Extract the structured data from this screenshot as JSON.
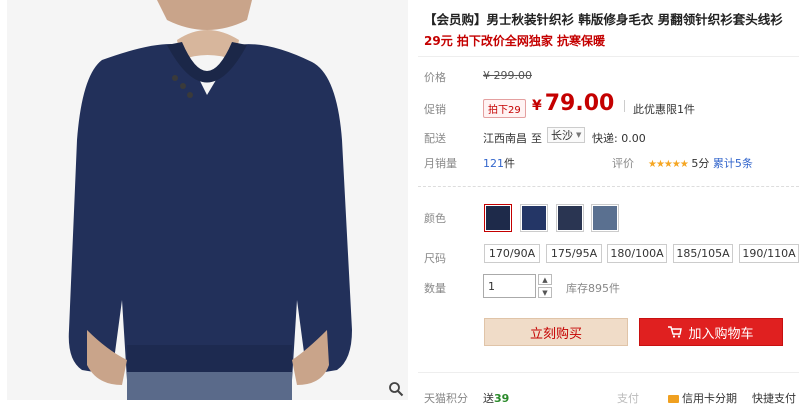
{
  "product": {
    "title": "【会员购】男士秋装针织衫 韩版修身毛衣 男翻领针织衫套头线衫",
    "promo": "29元 拍下改价全网独家 抗寒保暖"
  },
  "info": {
    "price_label": "价格",
    "original_price": "¥ 299.00",
    "promo_label": "促销",
    "promo_tag": "拍下29",
    "currency": "¥",
    "promo_price": "79.00",
    "promo_note": "此优惠限1件",
    "ship_label": "配送",
    "ship_from": "江西南昌",
    "ship_to_word": "至",
    "ship_to_city": "长沙",
    "ship_cost": "快递: 0.00",
    "sales_label": "月销量",
    "sales_count": "121",
    "sales_unit": "件",
    "rating_label": "评价",
    "stars": "★★★★★",
    "rating_score": "5分",
    "review_link": "累计5条"
  },
  "options": {
    "color_label": "颜色",
    "swatch_colors": [
      "#1e2a4a",
      "#243666",
      "#2a3552",
      "#5a7090"
    ],
    "size_label": "尺码",
    "sizes": [
      "170/90A",
      "175/95A",
      "180/100A",
      "185/105A",
      "190/110A"
    ],
    "qty_label": "数量",
    "qty_value": "1",
    "stock": "库存895件"
  },
  "buttons": {
    "buy_now": "立刻购买",
    "add_to_cart": "加入购物车"
  },
  "footer": {
    "points_label": "天猫积分",
    "points_prefix": "送",
    "points_value": "39",
    "pay_label": "支付",
    "installment": "信用卡分期",
    "quick_pay": "快捷支付"
  },
  "colors": {
    "accent_red": "#c40000",
    "cart_red": "#e02020",
    "link_blue": "#3366cc",
    "star": "#f5a623"
  }
}
